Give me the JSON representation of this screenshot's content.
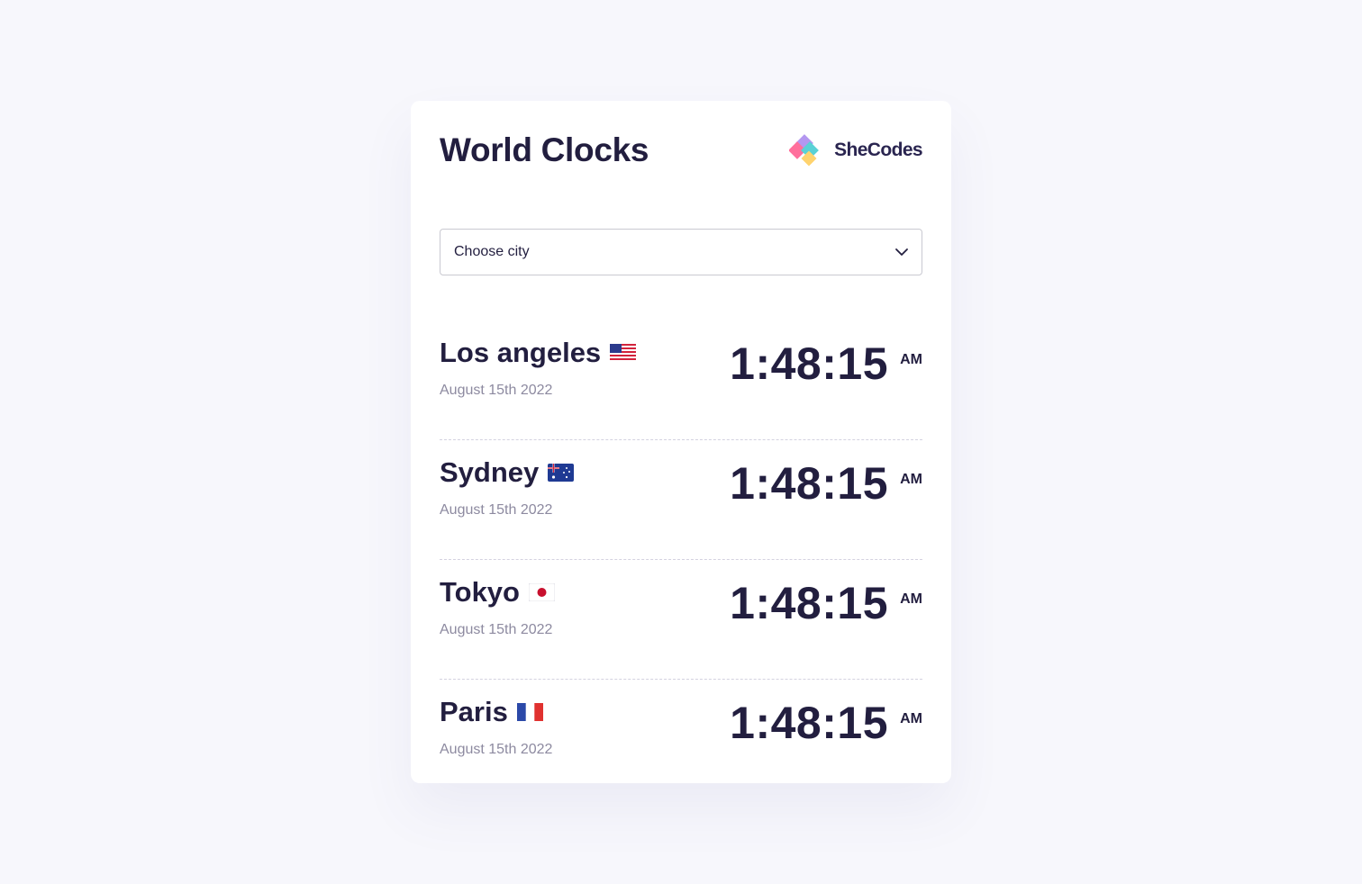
{
  "header": {
    "title": "World Clocks",
    "brand": "SheCodes"
  },
  "city_select": {
    "value": "Choose city",
    "icon": "chevron-down-icon"
  },
  "cities": [
    {
      "name": "Los angeles",
      "flag": "us-flag-icon",
      "date": "August 15th 2022",
      "time": "1:48:15",
      "ampm": "AM"
    },
    {
      "name": "Sydney",
      "flag": "au-flag-icon",
      "date": "August 15th 2022",
      "time": "1:48:15",
      "ampm": "AM"
    },
    {
      "name": "Tokyo",
      "flag": "jp-flag-icon",
      "date": "August 15th 2022",
      "time": "1:48:15",
      "ampm": "AM"
    },
    {
      "name": "Paris",
      "flag": "fr-flag-icon",
      "date": "August 15th 2022",
      "time": "1:48:15",
      "ampm": "AM"
    }
  ],
  "colors": {
    "background": "#f7f7fc",
    "card": "#ffffff",
    "text": "#221e3f",
    "muted": "#8d8aa0",
    "divider": "#d4d2e0"
  }
}
